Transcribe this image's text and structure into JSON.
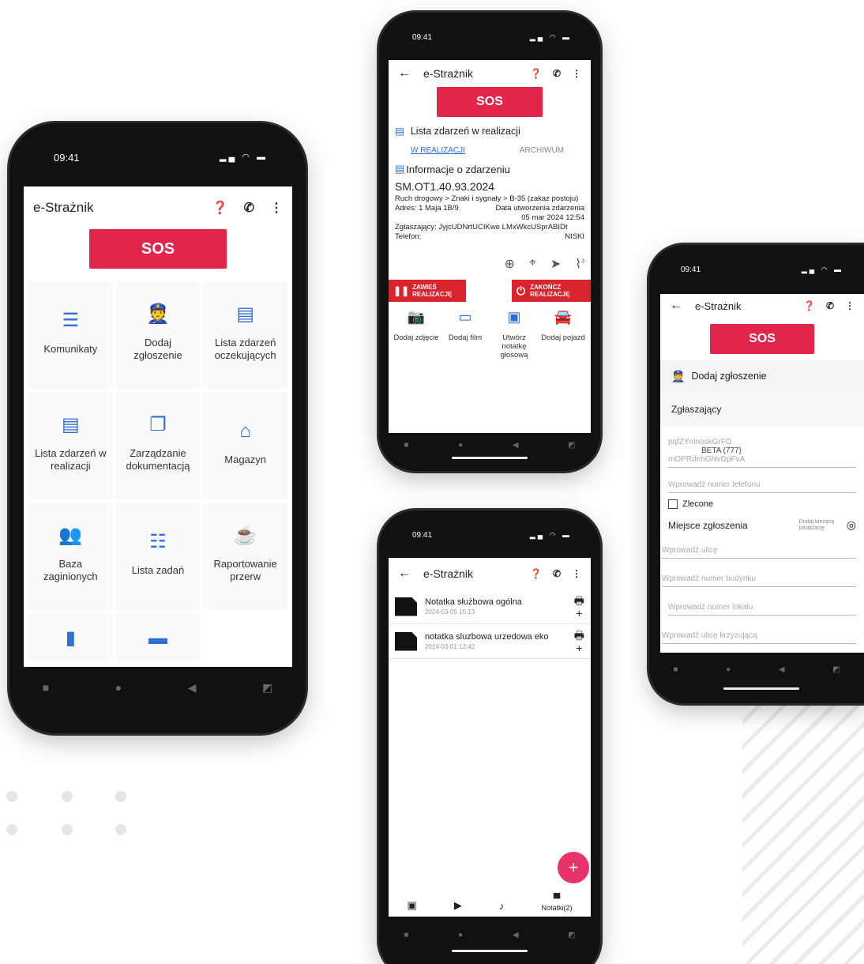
{
  "colors": {
    "sos": "#e2254a",
    "accent": "#2f6fd6",
    "stop": "#d9232d",
    "fab": "#e8336a"
  },
  "status": {
    "time": "09:41"
  },
  "app": {
    "title": "e-Strażnik",
    "sos": "SOS"
  },
  "home": {
    "tiles": [
      {
        "label": "Komunikaty",
        "icon": "message-icon"
      },
      {
        "label": "Dodaj zgłoszenie",
        "icon": "officer-icon"
      },
      {
        "label": "Lista zdarzeń oczekujących",
        "icon": "pending-list-icon"
      },
      {
        "label": "Lista zdarzeń w realizacji",
        "icon": "in-progress-list-icon"
      },
      {
        "label": "Zarządzanie dokumentacją",
        "icon": "documents-icon"
      },
      {
        "label": "Magazyn",
        "icon": "warehouse-icon"
      },
      {
        "label": "Baza zaginionych",
        "icon": "people-icon"
      },
      {
        "label": "Lista zadań",
        "icon": "task-list-icon"
      },
      {
        "label": "Raportowanie przerw",
        "icon": "coffee-icon"
      }
    ]
  },
  "realization": {
    "header": "Lista zdarzeń w realizacji",
    "tab_active": "W REALIZACJI",
    "tab_archive": "ARCHIWUM",
    "info_title": "Informacje o zdarzeniu",
    "case_number": "SM.OT1.40.93.2024",
    "category": "Ruch drogowy > Znaki i sygnały > B-35 (zakaz postoju)",
    "address": "Adres: 1 Maja 1B/9",
    "created_label": "Data utworzenia zdarzenia",
    "created_value": "05 mar 2024 12:54",
    "reporter": "Zgłaszający: JyjcUDNrtUCIKwe LMxWkcUSprABIDt",
    "phone_label": "Telefon:",
    "priority": "NISKI",
    "attach_count": "3",
    "suspend_label": "ZAWIEŚ REALIZACJĘ",
    "finish_label": "ZAKOŃCZ REALIZACJĘ",
    "actions": [
      {
        "label": "Dodaj zdjęcie",
        "icon": "camera-icon"
      },
      {
        "label": "Dodaj film",
        "icon": "video-icon"
      },
      {
        "label": "Utwórz notatkę głosową",
        "icon": "voice-note-icon"
      },
      {
        "label": "Dodaj pojazd",
        "icon": "car-icon"
      }
    ]
  },
  "notes": {
    "items": [
      {
        "title": "Notatka służbowa ogólna",
        "date": "2024-03-05 15:13"
      },
      {
        "title": "notatka sluzbowa urzedowa eko",
        "date": "2024-03-01 12:42"
      }
    ],
    "tab_notes": "Notatki(2)"
  },
  "report": {
    "section_title": "Dodaj zgłoszenie",
    "reporter_label": "Zgłaszający",
    "reporter_value1": "pqfZYnlnoskGrFO",
    "reporter_value2": "BETA (777)",
    "reporter_value3": "mOPRdehGNvDpFvA",
    "phone_placeholder": "Wprowadź numer telefonu",
    "ordered_label": "Zlecone",
    "place_label": "Miejsce zgłoszenia",
    "add_location": "Dodaj bieżącą lokalizację",
    "street": "Wprowadź ulicę",
    "building": "Wprowadź numer budynku",
    "unit": "Wprowadź numer lokalu",
    "cross": "Wprowadź ulicę krzyżującą"
  }
}
